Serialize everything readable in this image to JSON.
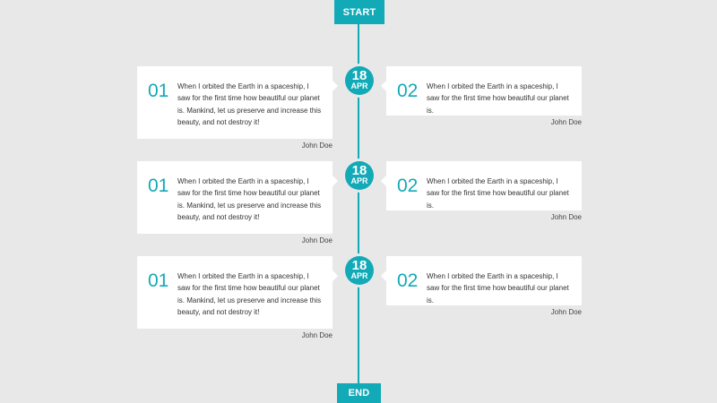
{
  "timeline": {
    "start_label": "START",
    "end_label": "END",
    "accent_color": "#12aab7",
    "background_color": "#e8e8e8",
    "entries": [
      {
        "date": {
          "day": "18",
          "month": "APR"
        },
        "left": {
          "number": "01",
          "text": "When I orbited the Earth in a spaceship, I saw for the first time how beautiful our planet is. Mankind, let us preserve and increase this beauty, and not destroy it!",
          "author": "John Doe"
        },
        "right": {
          "number": "02",
          "text": "When I orbited the Earth in a spaceship, I saw for the first time how beautiful our planet is.",
          "author": "John Doe"
        }
      },
      {
        "date": {
          "day": "18",
          "month": "APR"
        },
        "left": {
          "number": "01",
          "text": "When I orbited the Earth in a spaceship, I saw for the first time how beautiful our planet is. Mankind, let us preserve and increase this beauty, and not destroy it!",
          "author": "John Doe"
        },
        "right": {
          "number": "02",
          "text": "When I orbited the Earth in a spaceship, I saw for the first time how beautiful our planet is.",
          "author": "John Doe"
        }
      },
      {
        "date": {
          "day": "18",
          "month": "APR"
        },
        "left": {
          "number": "01",
          "text": "When I orbited the Earth in a spaceship, I saw for the first time how beautiful our planet is. Mankind, let us preserve and increase this beauty, and not destroy it!",
          "author": "John Doe"
        },
        "right": {
          "number": "02",
          "text": "When I orbited the Earth in a spaceship, I saw for the first time how beautiful our planet is.",
          "author": "John Doe"
        }
      }
    ]
  }
}
